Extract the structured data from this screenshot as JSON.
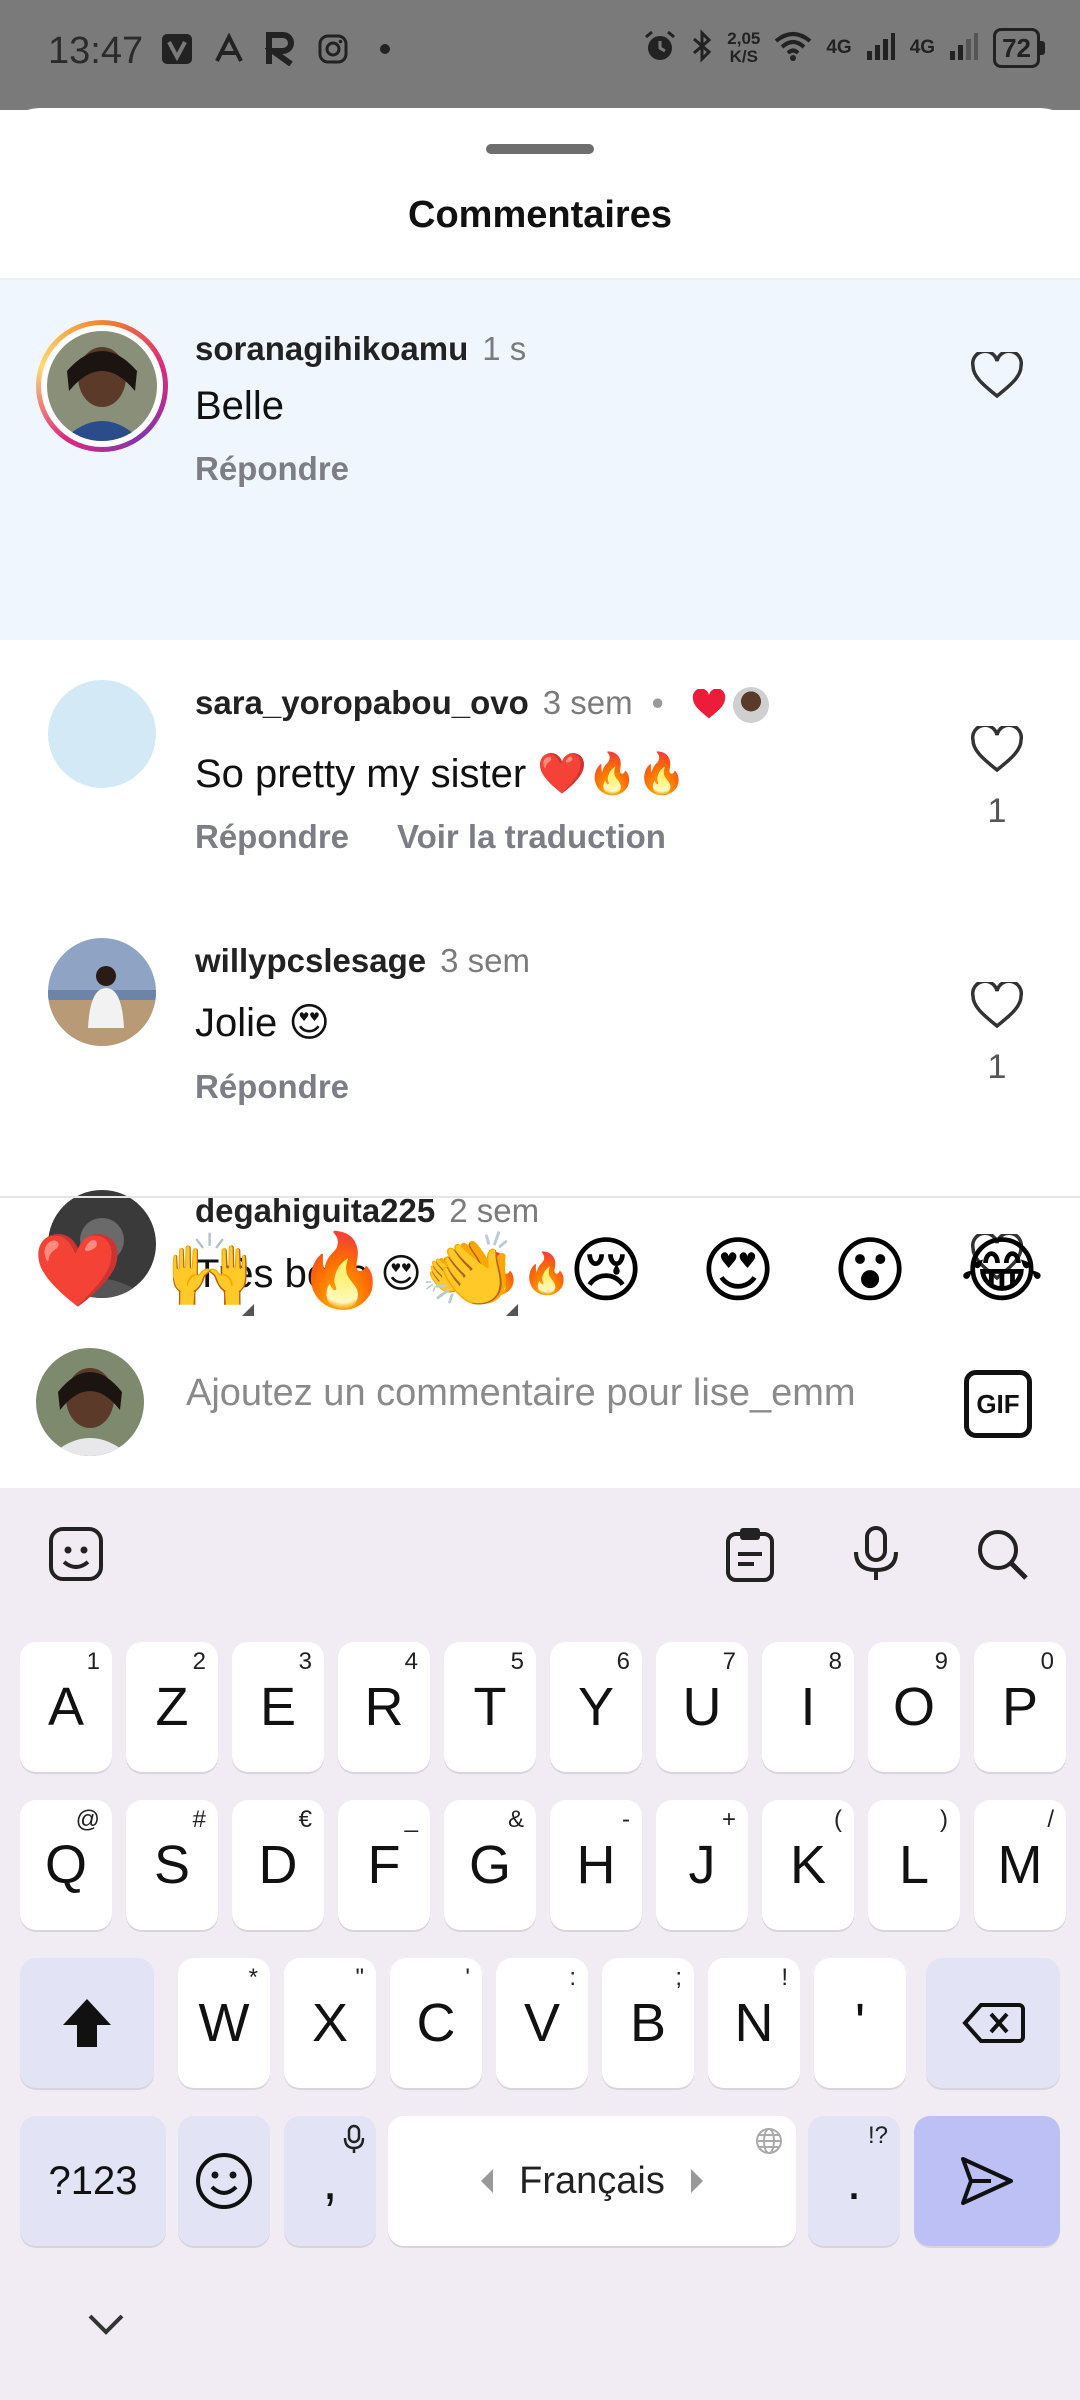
{
  "status_bar": {
    "time": "13:47",
    "left_icons": [
      "v-app-icon",
      "a-app-icon",
      "r-app-icon",
      "instagram-icon",
      "dot-icon"
    ],
    "speed_value": "2,05",
    "speed_unit": "K/S",
    "net1": "4G",
    "net2": "4G",
    "battery": "72"
  },
  "sheet": {
    "title": "Commentaires"
  },
  "comments": [
    {
      "username": "soranagihikoamu",
      "time": "1 s",
      "text": "Belle",
      "reply": "Répondre",
      "likes": ""
    },
    {
      "username": "sara_yoropabou_ovo",
      "time": "3 sem",
      "liked_by_author": "•",
      "text": "So pretty my sister ❤️🔥🔥",
      "reply": "Répondre",
      "translate": "Voir la traduction",
      "likes": "1"
    },
    {
      "username": "willypcslesage",
      "time": "3 sem",
      "text": "Jolie 😍",
      "reply": "Répondre",
      "likes": "1"
    },
    {
      "username": "degahiguita225",
      "time": "2 sem",
      "text": "Très belle 😍👏🔥🔥",
      "reply": "",
      "likes": ""
    }
  ],
  "quick_emojis": [
    "❤️",
    "🙌",
    "🔥",
    "👏",
    "😢",
    "😍",
    "😮",
    "😂"
  ],
  "comment_input": {
    "placeholder": "Ajoutez un commentaire pour lise_emm",
    "gif_label": "GIF"
  },
  "keyboard": {
    "row1": [
      {
        "k": "A",
        "s": "1"
      },
      {
        "k": "Z",
        "s": "2"
      },
      {
        "k": "E",
        "s": "3"
      },
      {
        "k": "R",
        "s": "4"
      },
      {
        "k": "T",
        "s": "5"
      },
      {
        "k": "Y",
        "s": "6"
      },
      {
        "k": "U",
        "s": "7"
      },
      {
        "k": "I",
        "s": "8"
      },
      {
        "k": "O",
        "s": "9"
      },
      {
        "k": "P",
        "s": "0"
      }
    ],
    "row2": [
      {
        "k": "Q",
        "s": "@"
      },
      {
        "k": "S",
        "s": "#"
      },
      {
        "k": "D",
        "s": "€"
      },
      {
        "k": "F",
        "s": "_"
      },
      {
        "k": "G",
        "s": "&"
      },
      {
        "k": "H",
        "s": "-"
      },
      {
        "k": "J",
        "s": "+"
      },
      {
        "k": "K",
        "s": "("
      },
      {
        "k": "L",
        "s": ")"
      },
      {
        "k": "M",
        "s": "/"
      }
    ],
    "row3": [
      {
        "k": "W",
        "s": "*"
      },
      {
        "k": "X",
        "s": "\""
      },
      {
        "k": "C",
        "s": "'"
      },
      {
        "k": "V",
        "s": ":"
      },
      {
        "k": "B",
        "s": ";"
      },
      {
        "k": "N",
        "s": "!"
      },
      {
        "k": "'",
        "s": ""
      }
    ],
    "symbols_key": "?123",
    "comma_key": ",",
    "space_label": "Français",
    "period_key": ".",
    "period_sup": "!?"
  }
}
